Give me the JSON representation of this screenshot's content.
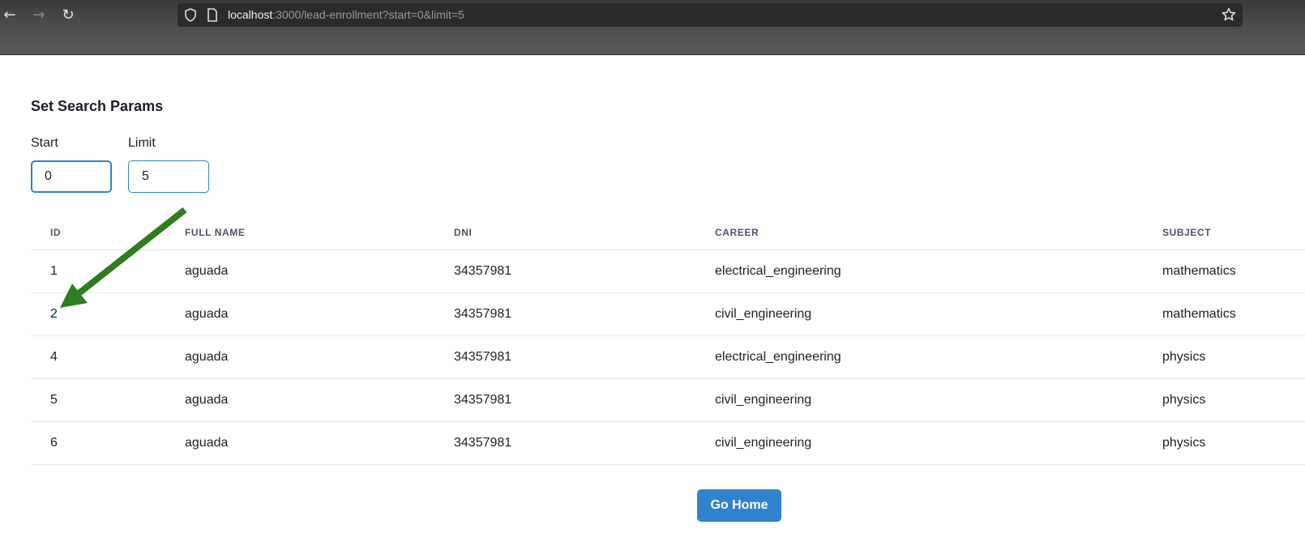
{
  "browser": {
    "url_host": "localhost",
    "url_rest": ":3000/lead-enrollment?start=0&limit=5"
  },
  "page": {
    "title": "Set Search Params",
    "start_label": "Start",
    "start_value": "0",
    "limit_label": "Limit",
    "limit_value": "5",
    "go_home_label": "Go Home"
  },
  "table": {
    "headers": [
      "ID",
      "FULL NAME",
      "DNI",
      "CAREER",
      "SUBJECT"
    ],
    "rows": [
      [
        "1",
        "aguada",
        "34357981",
        "electrical_engineering",
        "mathematics"
      ],
      [
        "2",
        "aguada",
        "34357981",
        "civil_engineering",
        "mathematics"
      ],
      [
        "4",
        "aguada",
        "34357981",
        "electrical_engineering",
        "physics"
      ],
      [
        "5",
        "aguada",
        "34357981",
        "civil_engineering",
        "physics"
      ],
      [
        "6",
        "aguada",
        "34357981",
        "civil_engineering",
        "physics"
      ]
    ]
  },
  "annotation": {
    "arrow_color": "#2e7d1e"
  },
  "colors": {
    "accent": "#3182ce"
  }
}
